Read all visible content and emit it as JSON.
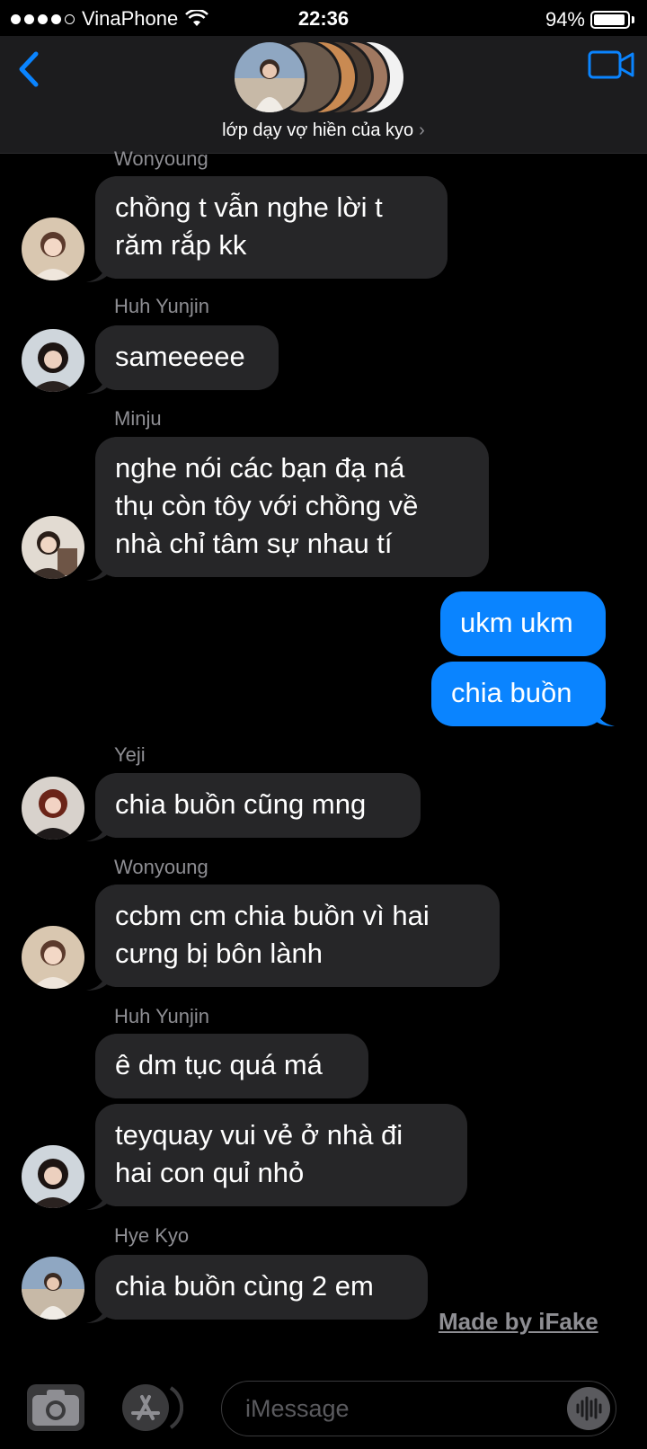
{
  "status_bar": {
    "carrier": "VinaPhone",
    "time": "22:36",
    "battery_text": "94%",
    "battery_level": 0.94
  },
  "header": {
    "group_name": "lớp dạy vợ hiền của kyo",
    "chevron": "›"
  },
  "messages": [
    {
      "sender": "Wonyoung",
      "lines": [
        "chồng t vẫn nghe lời t",
        "răm rắp kk"
      ]
    },
    {
      "sender": "Huh Yunjin",
      "lines": [
        "sameeeee"
      ]
    },
    {
      "sender": "Minju",
      "lines": [
        "nghe nói các bạn đạ ná",
        "thụ còn tôy với chồng về",
        "nhà chỉ tâm sự nhau tí"
      ]
    },
    {
      "sender": "",
      "me": true,
      "lines": [
        "ukm ukm"
      ]
    },
    {
      "sender": "",
      "me": true,
      "lines": [
        "chia buồn"
      ]
    },
    {
      "sender": "Yeji",
      "lines": [
        "chia buồn cũng mng"
      ]
    },
    {
      "sender": "Wonyoung",
      "lines": [
        "ccbm cm chia buồn vì hai",
        "cưng bị bôn lành"
      ]
    },
    {
      "sender": "Huh Yunjin",
      "lines": [
        "ê dm tục quá má"
      ]
    },
    {
      "sender": "",
      "lines": [
        "teyquay vui vẻ ở nhà đi",
        "hai con quỉ nhỏ"
      ]
    },
    {
      "sender": "Hye Kyo",
      "lines": [
        "chia buồn cùng 2 em"
      ]
    }
  ],
  "watermark": "Made by iFake",
  "composer": {
    "placeholder": "iMessage"
  },
  "colors": {
    "background": "#000000",
    "incoming_bubble": "#262628",
    "outgoing_bubble": "#0a84ff",
    "accent": "#0a84ff",
    "secondary_text": "#8e8e93"
  },
  "icons": [
    "back-chevron-icon",
    "video-camera-icon",
    "camera-icon",
    "app-store-icon",
    "audio-waveform-icon",
    "wifi-icon",
    "battery-icon"
  ]
}
